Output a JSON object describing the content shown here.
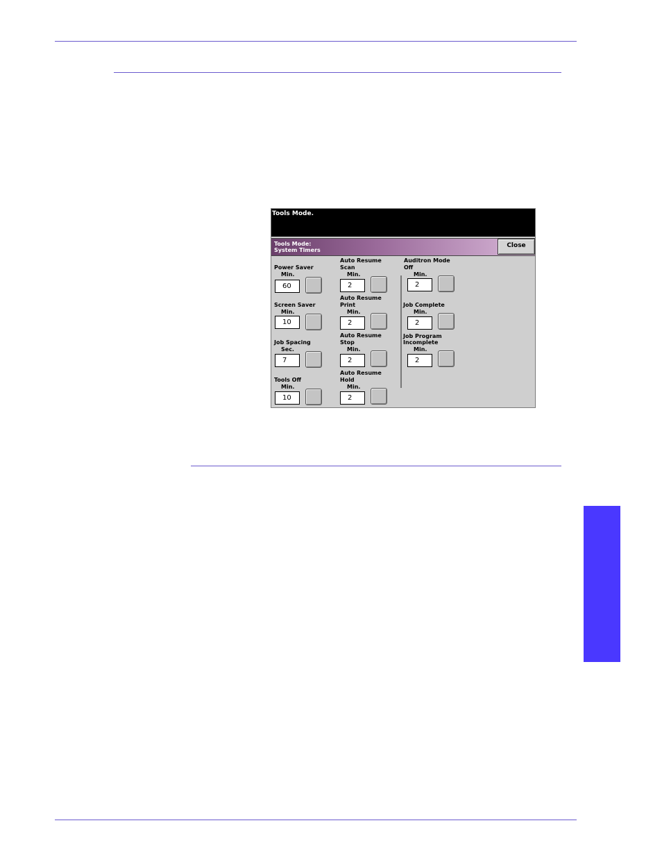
{
  "screen": {
    "message": "Tools  Mode.",
    "title_line1": "Tools  Mode:",
    "title_line2": "System  Timers",
    "close_label": "Close"
  },
  "timers": {
    "power_saver": {
      "label": "Power  Saver",
      "unit": "Min.",
      "value": "60"
    },
    "screen_saver": {
      "label": "Screen  Saver",
      "unit": "Min.",
      "value": "10"
    },
    "job_spacing": {
      "label": "Job  Spacing",
      "unit": "Sec.",
      "value": "7"
    },
    "tools_off": {
      "label": "Tools  Off",
      "unit": "Min.",
      "value": "10"
    },
    "auto_resume_scan": {
      "label1": "Auto  Resume",
      "label2": "Scan",
      "unit": "Min.",
      "value": "2"
    },
    "auto_resume_print": {
      "label1": "Auto  Resume",
      "label2": "Print",
      "unit": "Min.",
      "value": "2"
    },
    "auto_resume_stop": {
      "label1": "Auto  Resume",
      "label2": "Stop",
      "unit": "Min.",
      "value": "2"
    },
    "auto_resume_hold": {
      "label1": "Auto  Resume",
      "label2": "Hold",
      "unit": "Min.",
      "value": "2"
    },
    "auditron_mode_off": {
      "label1": "Auditron  Mode",
      "label2": "Off",
      "unit": "Min.",
      "value": "2"
    },
    "job_complete": {
      "label": "Job  Complete",
      "unit": "Min.",
      "value": "2"
    },
    "job_program_incomplete": {
      "label1": "Job  Program",
      "label2": "Incomplete",
      "unit": "Min.",
      "value": "2"
    }
  }
}
